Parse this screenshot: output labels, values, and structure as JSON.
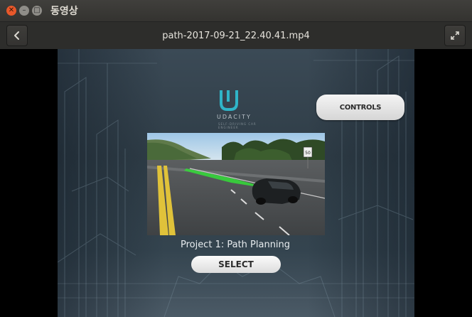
{
  "window": {
    "title": "동영상",
    "close_glyph": "✕",
    "minimize_glyph": "–",
    "maximize_glyph": "□"
  },
  "header": {
    "file_title": "path-2017-09-21_22.40.41.mp4",
    "back_icon": "chevron-left-icon",
    "fullscreen_icon": "expand-icon"
  },
  "video": {
    "brand_name": "UDACITY",
    "brand_tagline": "SELF-DRIVING CAR ENGINEER",
    "controls_label": "CONTROLS",
    "project_label": "Project 1: Path Planning",
    "select_label": "SELECT",
    "sign_text": "50"
  },
  "colors": {
    "titlebar": "#3a3936",
    "headerbar": "#2d2d2b",
    "close_button": "#e9582a",
    "brand_teal": "#2fb5c8",
    "path_green": "#35d63a"
  }
}
